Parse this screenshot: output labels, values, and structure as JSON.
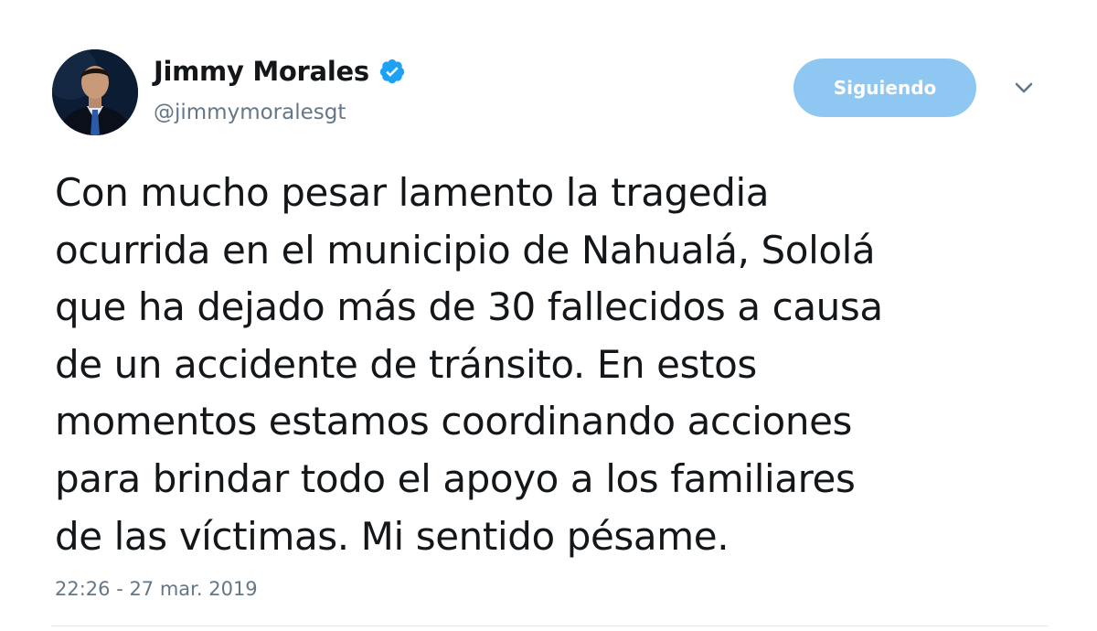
{
  "tweet": {
    "author": {
      "display_name": "Jimmy Morales",
      "handle": "@jimmymoralesgt",
      "verified": true,
      "avatar_icon": "profile-photo"
    },
    "follow_button_label": "Siguiendo",
    "menu_icon": "chevron-down-icon",
    "text": "Con mucho pesar lamento la tragedia\nocurrida en el municipio de Nahualá, Sololá\nque ha dejado más de 30 fallecidos a causa\nde un accidente de tránsito. En estos\nmomentos estamos coordinando acciones\npara brindar todo el apoyo a los familiares\nde las víctimas. Mi sentido pésame.",
    "timestamp": "22:26 - 27 mar. 2019"
  },
  "colors": {
    "follow_button_bg": "#8ec8f2",
    "verified_blue": "#1da1f2",
    "secondary_text": "#657786",
    "primary_text": "#14171a"
  }
}
